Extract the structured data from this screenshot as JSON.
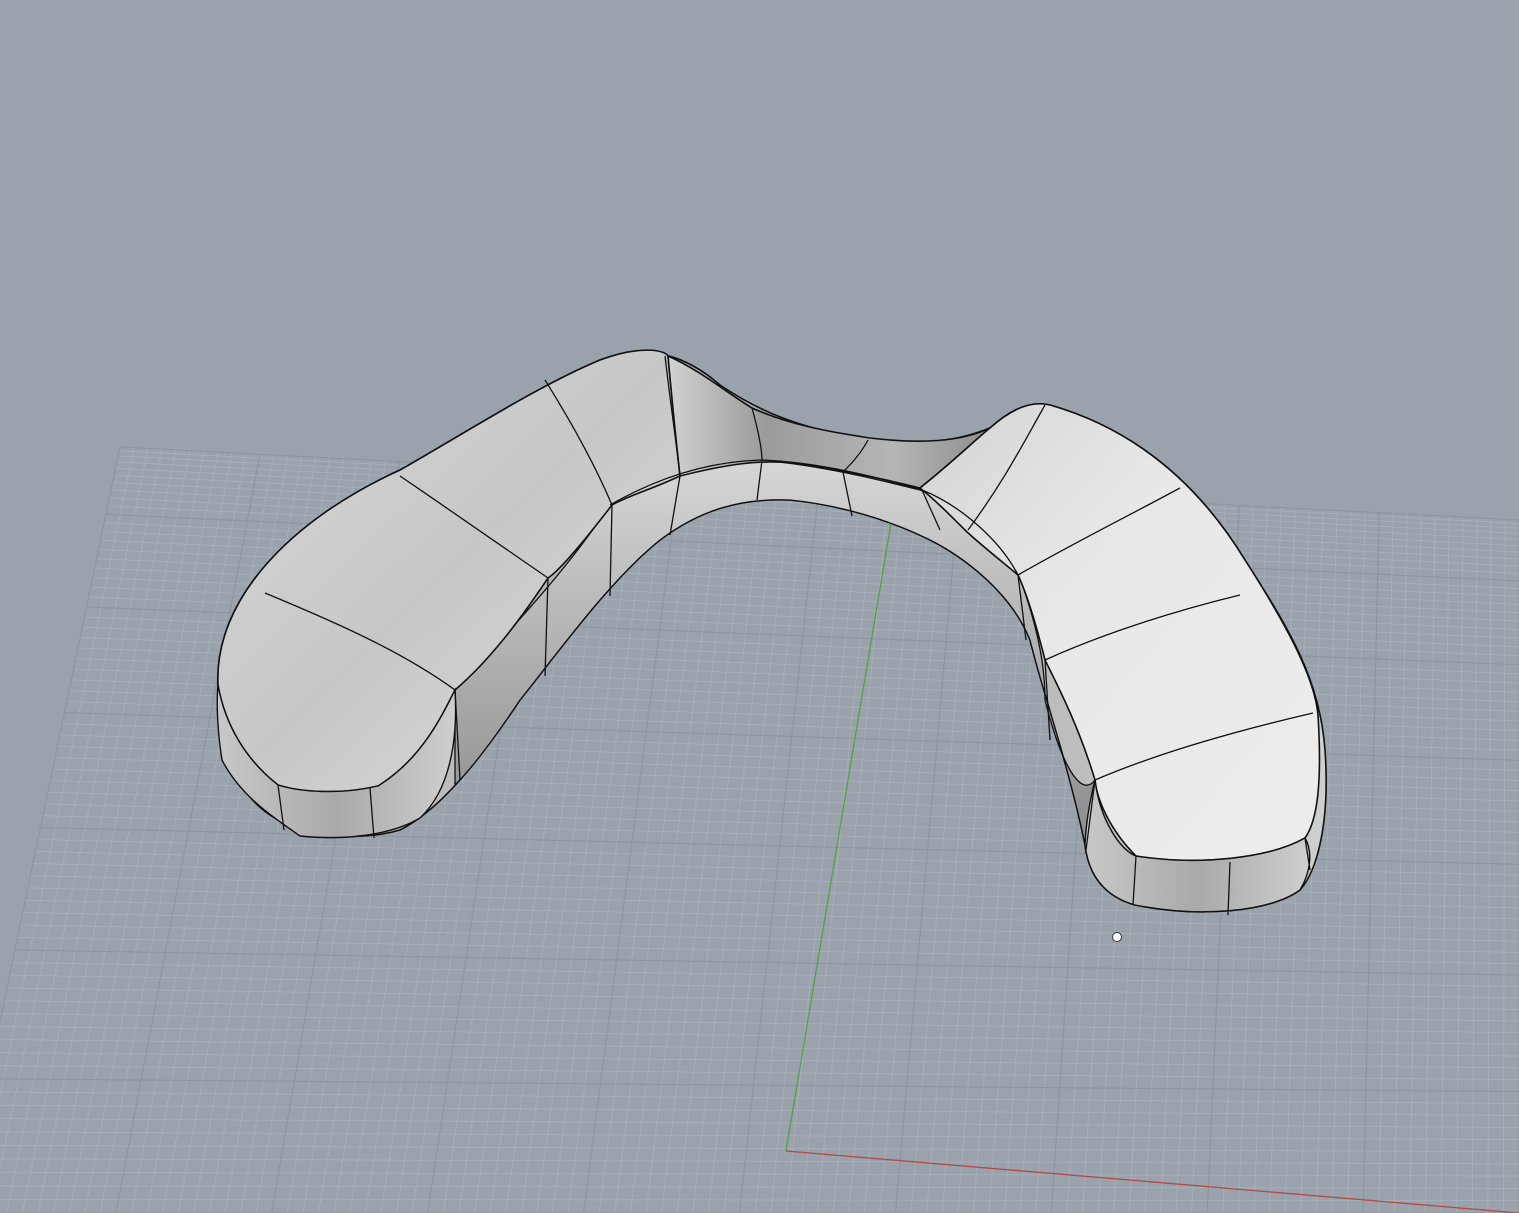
{
  "viewport": {
    "projection": "perspective",
    "display_mode": "shaded"
  },
  "colors": {
    "background": "#9aa2ab",
    "grid_minor": "#a9b1ba",
    "grid_major": "#8d959e",
    "x_axis": "#b54a46",
    "y_axis": "#4fa34a",
    "surface_light": "#e6e6e6",
    "surface_mid": "#c9c9c9",
    "surface_dark": "#8d8d8d",
    "edge": "#111111",
    "marker": "#ffffff"
  },
  "scene": {
    "grid_visible": true,
    "axes_visible": true,
    "objects": [
      {
        "name": "mouthguard-polysurface",
        "type": "polysurface",
        "edges_visible": true
      }
    ],
    "markers": [
      {
        "name": "point-object",
        "type": "point"
      }
    ]
  }
}
